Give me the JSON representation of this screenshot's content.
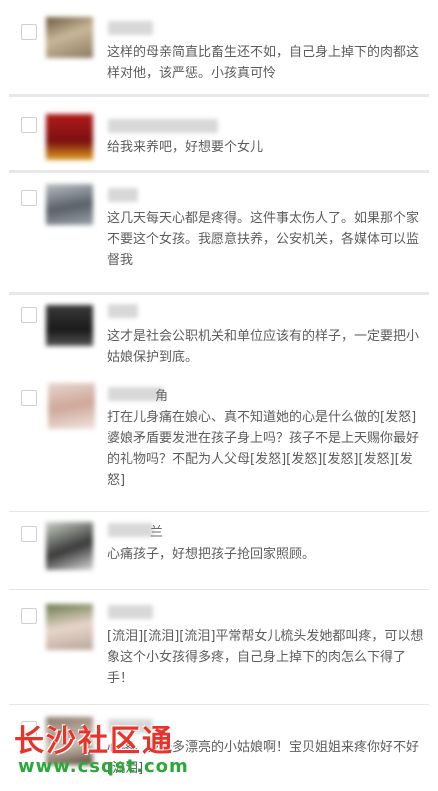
{
  "comments": [
    {
      "text": "这样的母亲简直比畜生还不如，自己身上掉下的肉都这样对他，该严惩。小孩真可怜"
    },
    {
      "text": "给我来养吧，好想要个女儿"
    },
    {
      "text": "这几天每天心都是疼得。这件事太伤人了。如果那个家不要这个女孩。我愿意扶养，公安机关，各媒体可以监督我"
    },
    {
      "text": "这才是社会公职机关和单位应该有的样子，一定要把小姑娘保护到底。"
    },
    {
      "name_visible": "角",
      "text": "打在儿身痛在娘心、真不知道她的心是什么做的[发怒]婆娘矛盾要发泄在孩子身上吗？孩子不是上天赐你最好的礼物吗？不配为人父母[发怒][发怒][发怒][发怒][发怒]"
    },
    {
      "name_visible": "兰",
      "text": "心痛孩子，好想把孩子抢回家照顾。"
    },
    {
      "text": "[流泪][流泪][流泪]平常帮女儿梳头发她都叫疼，可以想象这个小女孩得多疼，自己身上掉下的肉怎么下得了手！"
    },
    {
      "text": "心疼，多好多漂亮的小姑娘啊！宝贝姐姐来疼你好不好[流泪]"
    }
  ],
  "watermark": {
    "title": "长沙社区通",
    "url": "www.csqst.com",
    "colors": {
      "title": "#e8322a",
      "url": "#2aa83a"
    }
  }
}
